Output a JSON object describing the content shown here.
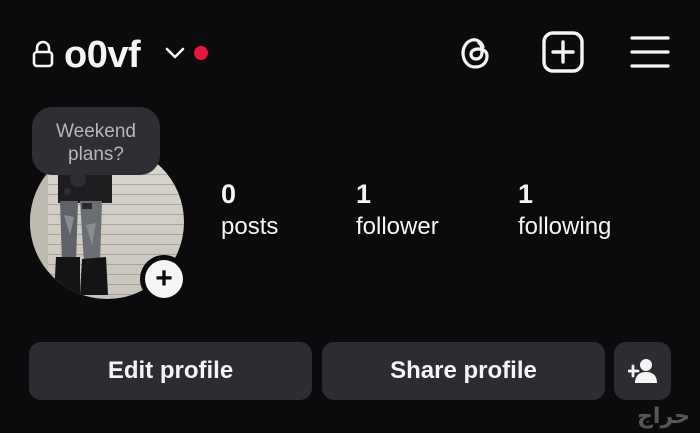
{
  "header": {
    "username": "o0vf",
    "icons": {
      "lock": "lock-icon",
      "chevron": "chevron-down-icon",
      "threads": "threads-icon",
      "new_post": "plus-square-icon",
      "menu": "hamburger-menu-icon"
    },
    "notification_dot_color": "#e8173a"
  },
  "note": {
    "text": "Weekend plans?"
  },
  "stats": {
    "posts": {
      "value": "0",
      "label": "posts"
    },
    "followers": {
      "value": "1",
      "label": "follower"
    },
    "following": {
      "value": "1",
      "label": "following"
    }
  },
  "actions": {
    "edit_label": "Edit profile",
    "share_label": "Share profile",
    "add_person_icon": "add-person-icon"
  },
  "watermark": {
    "text": "حراج"
  },
  "colors": {
    "background": "#0b0b0d",
    "button_bg": "#2c2d31",
    "text": "#f5f5f5",
    "note_bg": "#2e2f33"
  }
}
